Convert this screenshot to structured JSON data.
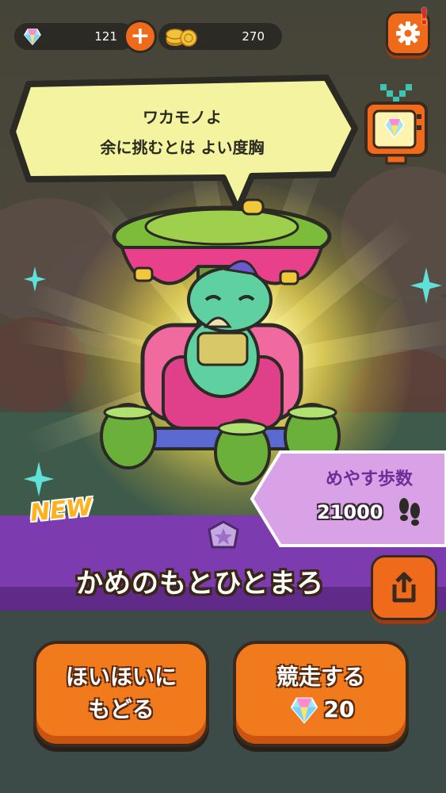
{
  "top_bar": {
    "gems": "121",
    "plus_label": "+",
    "coins": "270",
    "alert_mark": "!"
  },
  "speech_bubble": {
    "line1": "ワカモノよ",
    "line2": "余に挑むとは よい度胸"
  },
  "badge": "NEW",
  "character_name": "かめのもとひとまろ",
  "steps_panel": {
    "label": "めやす歩数",
    "value": "21000"
  },
  "buttons": {
    "back_line1": "ほいほいに",
    "back_line2": "もどる",
    "race_label": "競走する",
    "race_cost": "20"
  },
  "colors": {
    "accent_orange": "#f06a1c",
    "band_purple": "#7d3bb0",
    "panel_lilac": "#d9a2e6",
    "bubble_yellow": "#f3f3a0"
  },
  "icons": [
    "gem-icon",
    "coin-icon",
    "plus-icon",
    "gear-icon",
    "tv-icon",
    "share-icon",
    "footprints-icon",
    "star-icon"
  ]
}
